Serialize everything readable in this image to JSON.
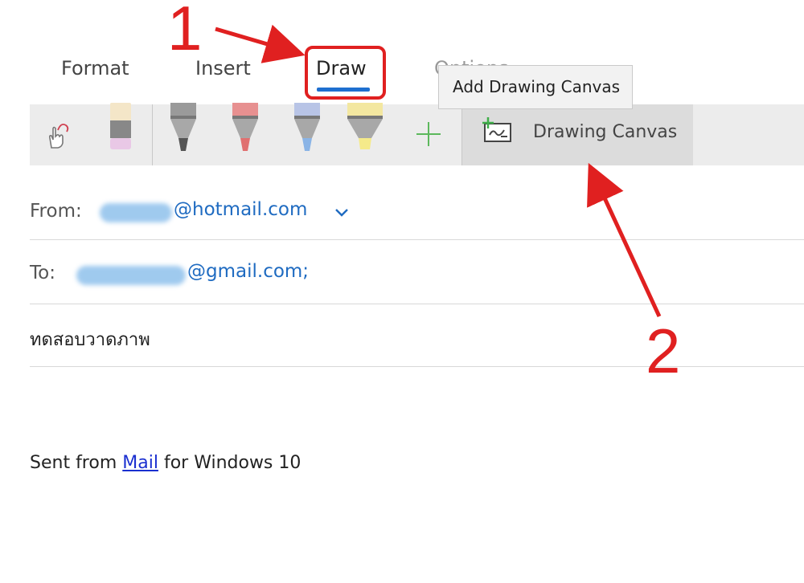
{
  "tabs": {
    "format": "Format",
    "insert": "Insert",
    "draw": "Draw",
    "options": "Options"
  },
  "annotations": {
    "step1": "1",
    "step2": "2"
  },
  "tooltip": {
    "text": "Add Drawing Canvas"
  },
  "toolbar": {
    "tools": [
      "touch-draw-icon",
      "eraser-icon",
      "pen-gray-icon",
      "pen-red-icon",
      "pencil-blue-icon",
      "highlighter-yellow-icon",
      "add-pen-icon"
    ],
    "drawing_canvas_label": "Drawing Canvas"
  },
  "from": {
    "label": "From:",
    "email_suffix": "@hotmail.com"
  },
  "to": {
    "label": "To:",
    "email_suffix": "@gmail.com;"
  },
  "subject": "ทดสอบวาดภาพ",
  "body": {
    "prefix": "Sent from ",
    "link": "Mail",
    "suffix": " for Windows 10"
  },
  "colors": {
    "accent": "#1e6fd0",
    "annotation_red": "#e02020",
    "link": "#1a2fd0"
  }
}
